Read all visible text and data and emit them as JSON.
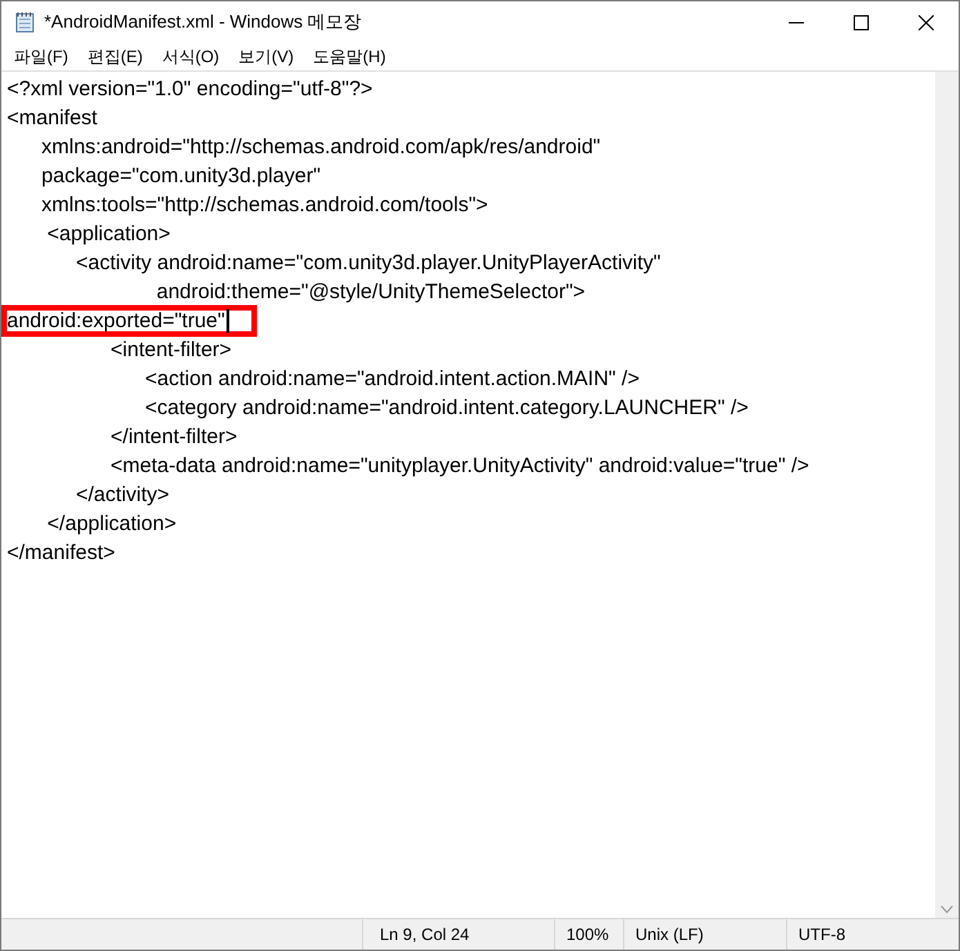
{
  "window": {
    "title": "*AndroidManifest.xml - Windows 메모장"
  },
  "menu": [
    "파일(F)",
    "편집(E)",
    "서식(O)",
    "보기(V)",
    "도움말(H)"
  ],
  "lines": [
    {
      "text": "<?xml version=\"1.0\" encoding=\"utf-8\"?>",
      "highlighted": false,
      "cursor": false
    },
    {
      "text": "<manifest",
      "highlighted": false,
      "cursor": false
    },
    {
      "text": "      xmlns:android=\"http://schemas.android.com/apk/res/android\"",
      "highlighted": false,
      "cursor": false
    },
    {
      "text": "      package=\"com.unity3d.player\"",
      "highlighted": false,
      "cursor": false
    },
    {
      "text": "      xmlns:tools=\"http://schemas.android.com/tools\">",
      "highlighted": false,
      "cursor": false
    },
    {
      "text": "       <application>",
      "highlighted": false,
      "cursor": false
    },
    {
      "text": "            <activity android:name=\"com.unity3d.player.UnityPlayerActivity\"",
      "highlighted": false,
      "cursor": false
    },
    {
      "text": "                          android:theme=\"@style/UnityThemeSelector\">",
      "highlighted": false,
      "cursor": false
    },
    {
      "text": "android:exported=\"true\"",
      "highlighted": true,
      "cursor": true
    },
    {
      "text": "                  <intent-filter>",
      "highlighted": false,
      "cursor": false
    },
    {
      "text": "                        <action android:name=\"android.intent.action.MAIN\" />",
      "highlighted": false,
      "cursor": false
    },
    {
      "text": "                        <category android:name=\"android.intent.category.LAUNCHER\" />",
      "highlighted": false,
      "cursor": false
    },
    {
      "text": "                  </intent-filter>",
      "highlighted": false,
      "cursor": false
    },
    {
      "text": "                  <meta-data android:name=\"unityplayer.UnityActivity\" android:value=\"true\" />",
      "highlighted": false,
      "cursor": false
    },
    {
      "text": "            </activity>",
      "highlighted": false,
      "cursor": false
    },
    {
      "text": "       </application>",
      "highlighted": false,
      "cursor": false
    },
    {
      "text": "</manifest>",
      "highlighted": false,
      "cursor": false
    }
  ],
  "status_bar": {
    "position": "Ln 9, Col 24",
    "zoom": "100%",
    "line_ending": "Unix (LF)",
    "encoding": "UTF-8"
  }
}
